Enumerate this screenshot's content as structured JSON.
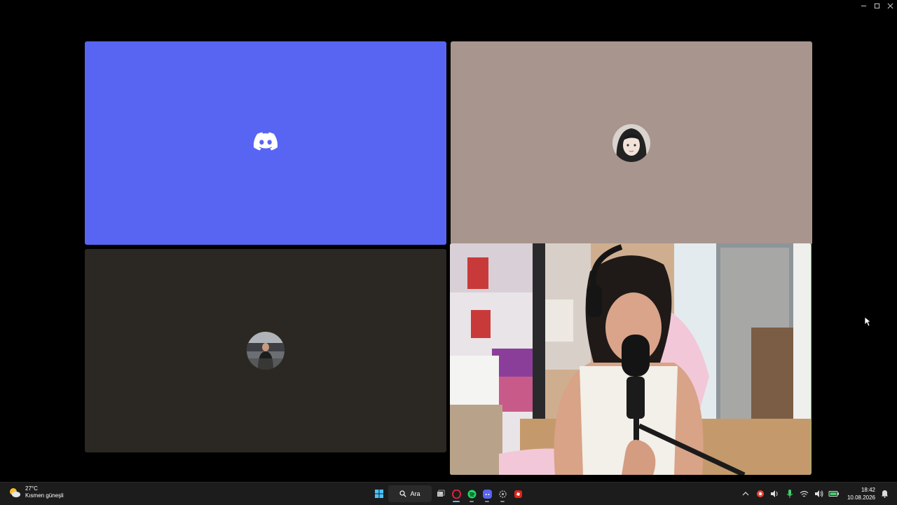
{
  "window": {
    "controls": [
      "minimize",
      "maximize",
      "close"
    ]
  },
  "tiles": {
    "discord_tile": {
      "icon": "discord-logo-icon",
      "bg": "#5865f2"
    },
    "user2_tile": {
      "avatar": "anime-avatar",
      "bg": "#a8958e"
    },
    "user3_tile": {
      "avatar": "user-photo-avatar",
      "bg": "#2b2823"
    },
    "camera_tile": {
      "content": "webcam-stream"
    }
  },
  "taskbar": {
    "weather": {
      "temp": "27°C",
      "desc": "Kısmen güneşli"
    },
    "search_label": "Ara",
    "apps": [
      "windows-start-icon",
      "search",
      "task-view-icon",
      "opera-icon",
      "spotify-icon",
      "discord-icon",
      "settings-icon",
      "roblox-icon"
    ],
    "clock": {
      "time": "18:42",
      "date": "10.08.2026"
    }
  }
}
